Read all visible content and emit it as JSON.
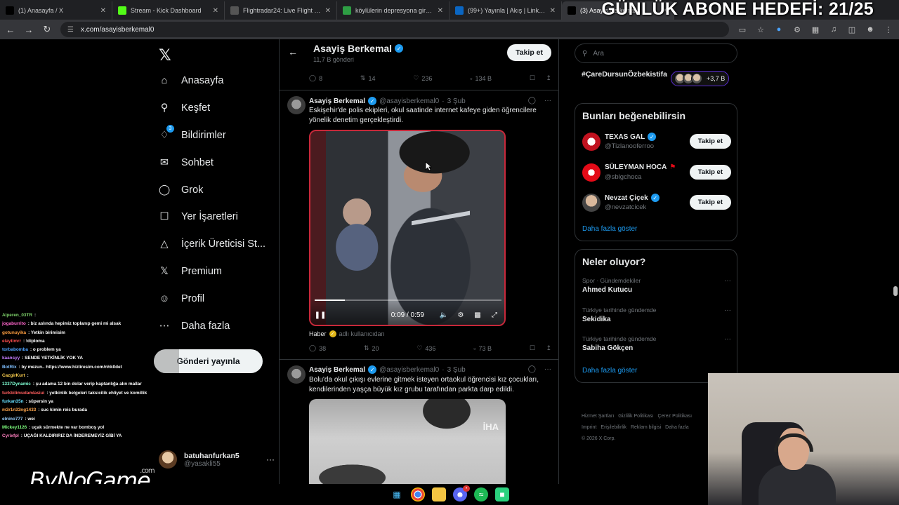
{
  "browser": {
    "tabs": [
      {
        "title": "(1) Anasayfa / X",
        "favicon": "x-logo",
        "color": "#000000",
        "active": false
      },
      {
        "title": "Stream - Kick Dashboard",
        "favicon": "kick-logo",
        "color": "#53fc18",
        "active": false
      },
      {
        "title": "Flightradar24: Live Flight Tracker",
        "favicon": "radar-logo",
        "color": "#555555",
        "active": false
      },
      {
        "title": "köylülerin depresyona girmeme...",
        "favicon": "leaf-logo",
        "color": "#2e9e44",
        "active": false
      },
      {
        "title": "(99+) Yayınla | Akış | LinkedIn",
        "favicon": "linkedin-logo",
        "color": "#0a66c2",
        "active": false
      },
      {
        "title": "(3) Asayiş Berkemal",
        "favicon": "x-logo",
        "color": "#000000",
        "active": true
      }
    ],
    "overlay_text": "GÜNLÜK ABONE HEDEFİ: 21/25",
    "url": "x.com/asayisberkemal0"
  },
  "nav": {
    "items": [
      {
        "label": "Anasayfa",
        "icon": "home-icon"
      },
      {
        "label": "Keşfet",
        "icon": "search-icon"
      },
      {
        "label": "Bildirimler",
        "icon": "bell-icon",
        "badge": "3"
      },
      {
        "label": "Sohbet",
        "icon": "mail-icon"
      },
      {
        "label": "Grok",
        "icon": "grok-icon"
      },
      {
        "label": "Yer İşaretleri",
        "icon": "bookmark-icon"
      },
      {
        "label": "İçerik Üreticisi St...",
        "icon": "creator-studio-icon"
      },
      {
        "label": "Premium",
        "icon": "x-premium-icon"
      },
      {
        "label": "Profil",
        "icon": "person-icon"
      },
      {
        "label": "Daha fazla",
        "icon": "more-circle-icon"
      }
    ],
    "post_button": "Gönderi yayınla",
    "account": {
      "name": "batuhanfurkan5",
      "handle": "@yasakli55"
    }
  },
  "chat": [
    {
      "user": "Alperen_03TR",
      "color": "#7fd36b",
      "msg": ""
    },
    {
      "user": "jogaburrito",
      "color": "#ff66cc",
      "msg": "biz aslında hepimiz toplanıp gemi mi alsak"
    },
    {
      "user": "gotunuyika",
      "color": "#ff9f40",
      "msg": "Yetkin birimisim"
    },
    {
      "user": "elaytimrr",
      "color": "#ff4f4f",
      "msg": "!diploma"
    },
    {
      "user": "torbabomba",
      "color": "#4fa3ff",
      "msg": "o problem ya"
    },
    {
      "user": "kaansyy",
      "color": "#c77dff",
      "msg": "SENDE YETKİNLİK YOK YA"
    },
    {
      "user": "BotRix",
      "color": "#7fbfff",
      "msg": "by mezun.. https://www.hizliresim.com/nhk0det"
    },
    {
      "user": "CazgirKurt",
      "color": "#ffd24f",
      "msg": ""
    },
    {
      "user": "1337Dynamic",
      "color": "#7fffd4",
      "msg": "şu adama 12 bin dolar verip kaptanlığa alın mallar"
    },
    {
      "user": "turkbilimudamlasiui",
      "color": "#ff5e5e",
      "msg": "yetkinlik belgeleri taksicilik ehliyet ve komillik"
    },
    {
      "user": "furkan35n",
      "color": "#66e0ff",
      "msg": "süpersin ya"
    },
    {
      "user": "m3r1n33ng1433",
      "color": "#ffa64d",
      "msg": "suc kimin reis burada"
    },
    {
      "user": "elnino777",
      "color": "#9ad0ff",
      "msg": "wei"
    },
    {
      "user": "Mickey1126",
      "color": "#7fff7f",
      "msg": "uçak sürmekte ne var bomboş yol"
    },
    {
      "user": "Cyrixfpl",
      "color": "#ff7fbf",
      "msg": "UÇAĞI KALDIRIRIZ DA İNDEREMEYİZ GİBİ YA"
    }
  ],
  "watermark": {
    "text": "ByNoGame",
    "suffix": ".com"
  },
  "profile": {
    "name": "Asayiş Berkemal",
    "posts_count": "11,7 B gönderi",
    "follow_label": "Takip et"
  },
  "prev_tweet_actions": {
    "replies": "8",
    "reposts": "14",
    "likes": "236",
    "views": "134 B"
  },
  "tweets": [
    {
      "name": "Asayiş Berkemal",
      "handle": "@asayisberkemal0",
      "date": "3 Şub",
      "text": "Eskişehir'de polis ekipleri, okul saatinde internet kafeye giden öğrencilere yönelik denetim gerçekleştirdi.",
      "video_time": "0:09 / 0:59",
      "video_progress": 0.16,
      "source": "Haber",
      "source_suffix": "adlı kullanıcıdan",
      "replies": "38",
      "reposts": "20",
      "likes": "436",
      "views": "73 B"
    },
    {
      "name": "Asayiş Berkemal",
      "handle": "@asayisberkemal0",
      "date": "3 Şub",
      "text": "Bolu'da okul çıkışı evlerine gitmek isteyen ortaokul öğrencisi kız çocukları, kendilerinden yaşça büyük kız grubu tarafından parkta darp edildi.",
      "media_watermark": "İHA"
    }
  ],
  "right": {
    "search_placeholder": "Ara",
    "top_trend": "#ÇareDursunÖzbekistifa",
    "top_trend_count": "+3,7 B",
    "suggestions_title": "Bunları beğenebilirsin",
    "suggestions": [
      {
        "name": "TEXAS GAL",
        "handle": "@Tizlanooferroo",
        "verified": true,
        "follow": "Takip et"
      },
      {
        "name": "SÜLEYMAN HOCA",
        "handle": "@sblgchoca",
        "verified": false,
        "follow": "Takip et"
      },
      {
        "name": "Nevzat Çiçek",
        "handle": "@nevzatcicek",
        "verified": true,
        "follow": "Takip et"
      }
    ],
    "show_more": "Daha fazla göster",
    "trends_title": "Neler oluyor?",
    "trends": [
      {
        "category": "Spor · Gündemdekiler",
        "title": "Ahmed Kutucu"
      },
      {
        "category": "Türkiye tarihinde gündemde",
        "title": "Sekidika"
      },
      {
        "category": "Türkiye tarihinde gündemde",
        "title": "Sabiha Gökçen"
      }
    ],
    "footer": [
      "Hizmet Şartları",
      "Gizlilik Politikası",
      "Çerez Politikası",
      "Imprint",
      "Erişilebilirlik",
      "Reklam bilgisi",
      "Daha fazla",
      "© 2026 X Corp."
    ]
  }
}
